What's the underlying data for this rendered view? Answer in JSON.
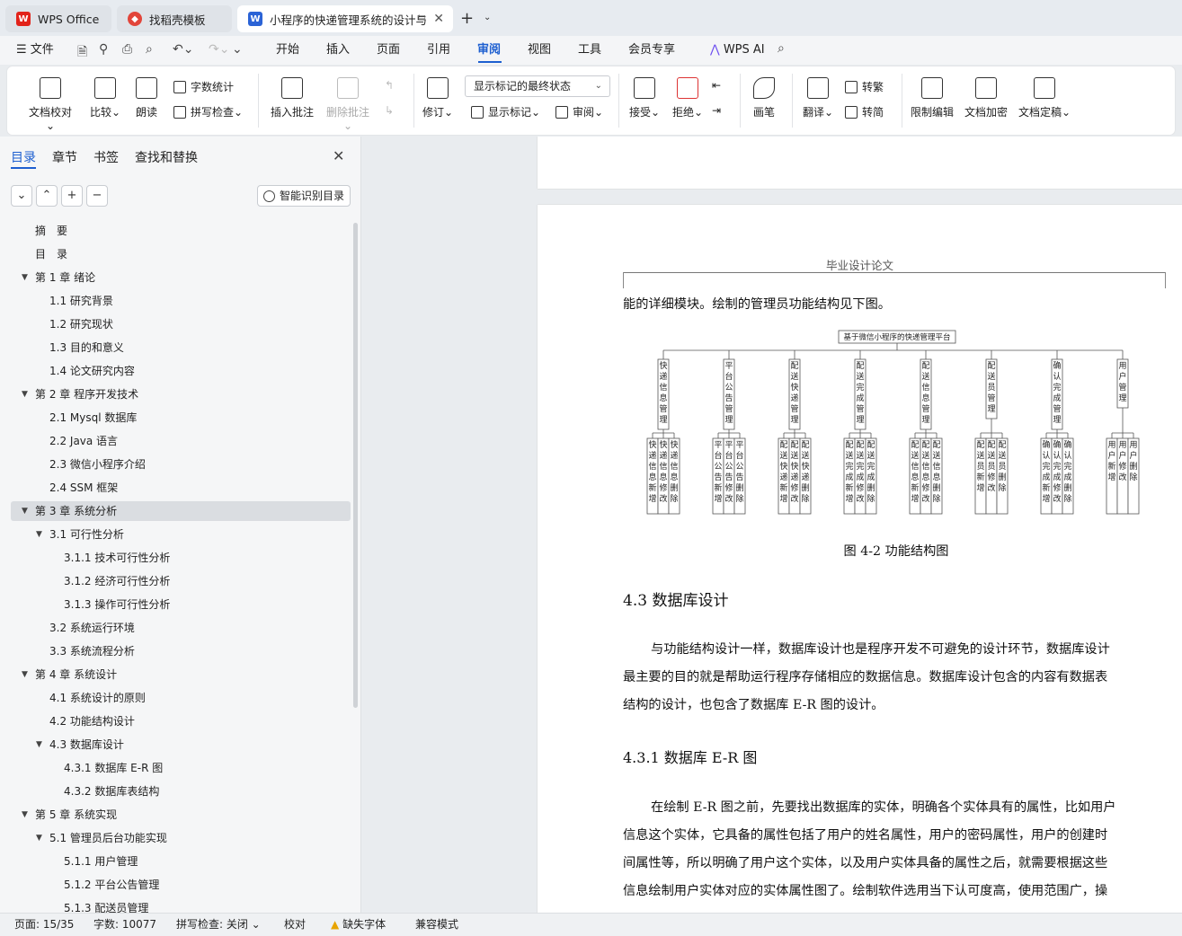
{
  "tabs": [
    {
      "label": "WPS Office",
      "icon": "wps-logo-icon"
    },
    {
      "label": "找稻壳模板",
      "icon": "docer-icon"
    },
    {
      "label": "小程序的快递管理系统的设计与",
      "icon": "word-doc-icon"
    }
  ],
  "menu": {
    "file": "文件",
    "items": [
      "开始",
      "插入",
      "页面",
      "引用",
      "审阅",
      "视图",
      "工具",
      "会员专享"
    ],
    "active": "审阅",
    "ai": "WPS AI"
  },
  "ribbon": {
    "doc_check": "文档校对",
    "compare": "比较",
    "read_aloud": "朗读",
    "word_count": "字数统计",
    "spell_check": "拼写检查",
    "insert_comment": "插入批注",
    "delete_comment": "删除批注",
    "revise": "修订",
    "markup_state": "显示标记的最终状态",
    "show_markup": "显示标记",
    "review": "审阅",
    "accept": "接受",
    "reject": "拒绝",
    "pen": "画笔",
    "translate": "翻译",
    "to_traditional": "转繁",
    "to_simplified": "转简",
    "restrict_edit": "限制编辑",
    "encrypt": "文档加密",
    "finalize": "文档定稿"
  },
  "sidebar": {
    "tabs": [
      "目录",
      "章节",
      "书签",
      "查找和替换"
    ],
    "smart_toc": "智能识别目录",
    "toc": [
      {
        "label": "摘　要",
        "level": 0,
        "expand": ""
      },
      {
        "label": "目　录",
        "level": 0,
        "expand": ""
      },
      {
        "label": "第 1 章  绪论",
        "level": 0,
        "expand": "▼"
      },
      {
        "label": "1.1  研究背景",
        "level": 1,
        "expand": ""
      },
      {
        "label": "1.2  研究现状",
        "level": 1,
        "expand": ""
      },
      {
        "label": "1.3  目的和意义",
        "level": 1,
        "expand": ""
      },
      {
        "label": "1.4  论文研究内容",
        "level": 1,
        "expand": ""
      },
      {
        "label": "第 2 章  程序开发技术",
        "level": 0,
        "expand": "▼"
      },
      {
        "label": "2.1 Mysql 数据库",
        "level": 1,
        "expand": ""
      },
      {
        "label": "2.2 Java 语言",
        "level": 1,
        "expand": ""
      },
      {
        "label": "2.3  微信小程序介绍",
        "level": 1,
        "expand": ""
      },
      {
        "label": "2.4 SSM 框架",
        "level": 1,
        "expand": ""
      },
      {
        "label": "第 3 章  系统分析",
        "level": 0,
        "expand": "▼"
      },
      {
        "label": "3.1 可行性分析",
        "level": 1,
        "expand": "▼"
      },
      {
        "label": "3.1.1 技术可行性分析",
        "level": 2,
        "expand": ""
      },
      {
        "label": "3.1.2 经济可行性分析",
        "level": 2,
        "expand": ""
      },
      {
        "label": "3.1.3 操作可行性分析",
        "level": 2,
        "expand": ""
      },
      {
        "label": "3.2 系统运行环境",
        "level": 1,
        "expand": ""
      },
      {
        "label": "3.3 系统流程分析",
        "level": 1,
        "expand": ""
      },
      {
        "label": "第 4 章  系统设计",
        "level": 0,
        "expand": "▼"
      },
      {
        "label": "4.1  系统设计的原则",
        "level": 1,
        "expand": ""
      },
      {
        "label": "4.2  功能结构设计",
        "level": 1,
        "expand": ""
      },
      {
        "label": "4.3  数据库设计",
        "level": 1,
        "expand": "▼"
      },
      {
        "label": "4.3.1  数据库 E-R 图",
        "level": 2,
        "expand": ""
      },
      {
        "label": "4.3.2  数据库表结构",
        "level": 2,
        "expand": ""
      },
      {
        "label": "第 5 章  系统实现",
        "level": 0,
        "expand": "▼"
      },
      {
        "label": "5.1 管理员后台功能实现",
        "level": 1,
        "expand": "▼"
      },
      {
        "label": "5.1.1  用户管理",
        "level": 2,
        "expand": ""
      },
      {
        "label": "5.1.2  平台公告管理",
        "level": 2,
        "expand": ""
      },
      {
        "label": "5.1.3  配送员管理",
        "level": 2,
        "expand": ""
      }
    ],
    "selected_index": 12
  },
  "document": {
    "header": "毕业设计论文",
    "intro_line": "能的详细模块。绘制的管理员功能结构见下图。",
    "figure": {
      "root": "基于微信小程序的快递管理平台",
      "modules": [
        {
          "name": "快递信息管理",
          "children": [
            "快递信息新增",
            "快递信息修改",
            "快递信息删除"
          ]
        },
        {
          "name": "平台公告管理",
          "children": [
            "平台公告新增",
            "平台公告修改",
            "平台公告删除"
          ]
        },
        {
          "name": "配送快递管理",
          "children": [
            "配送快递新增",
            "配送快递修改",
            "配送快递删除"
          ]
        },
        {
          "name": "配送完成管理",
          "children": [
            "配送完成新增",
            "配送完成修改",
            "配送完成删除"
          ]
        },
        {
          "name": "配送信息管理",
          "children": [
            "配送信息新增",
            "配送信息修改",
            "配送信息删除"
          ]
        },
        {
          "name": "配送员管理",
          "children": [
            "配送员新增",
            "配送员修改",
            "配送员删除"
          ]
        },
        {
          "name": "确认完成管理",
          "children": [
            "确认完成新增",
            "确认完成修改",
            "确认完成删除"
          ]
        },
        {
          "name": "用户管理",
          "children": [
            "用户新增",
            "用户修改",
            "用户删除"
          ]
        }
      ]
    },
    "caption": "图 4-2  功能结构图",
    "h2": "4.3  数据库设计",
    "para1": [
      "与功能结构设计一样，数据库设计也是程序开发不可避免的设计环节，数据库设计",
      "最主要的目的就是帮助运行程序存储相应的数据信息。数据库设计包含的内容有数据表",
      "结构的设计，也包含了数据库 E-R 图的设计。"
    ],
    "h3": "4.3.1  数据库 E-R 图",
    "para2": [
      "在绘制 E-R 图之前，先要找出数据库的实体，明确各个实体具有的属性，比如用户",
      "信息这个实体，它具备的属性包括了用户的姓名属性，用户的密码属性，用户的创建时",
      "间属性等，所以明确了用户这个实体，以及用户实体具备的属性之后，就需要根据这些",
      "信息绘制用户实体对应的实体属性图了。绘制软件选用当下认可度高，使用范围广，操"
    ]
  },
  "status": {
    "page": "页面: 15/35",
    "words": "字数: 10077",
    "spell": "拼写检查: 关闭",
    "proof": "校对",
    "missing_font": "缺失字体",
    "compat": "兼容模式"
  },
  "colors": {
    "accent": "#1d5fd0",
    "wps_red": "#e2231a"
  }
}
